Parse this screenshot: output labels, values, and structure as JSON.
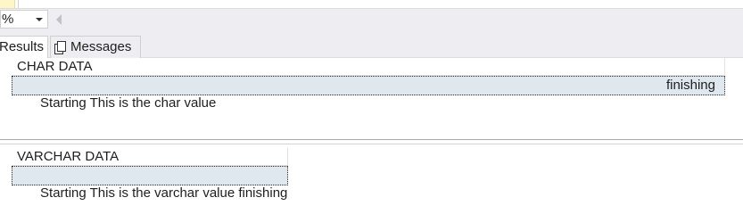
{
  "toolbar": {
    "zoom_value": "%"
  },
  "tabs": [
    {
      "label": "Results"
    },
    {
      "label": "Messages"
    }
  ],
  "result_sets": [
    {
      "column": "CHAR DATA",
      "cell_left": "Starting This is the char value",
      "cell_right": "finishing"
    },
    {
      "column": "VARCHAR DATA",
      "cell_left": "Starting This is the varchar value finishing"
    }
  ]
}
